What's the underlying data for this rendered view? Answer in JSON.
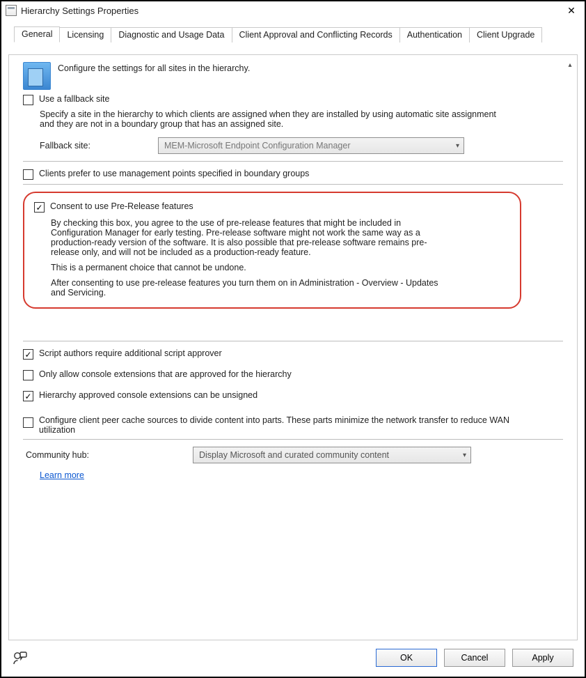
{
  "window": {
    "title": "Hierarchy Settings Properties",
    "close_glyph": "✕"
  },
  "tabs": {
    "general": "General",
    "licensing": "Licensing",
    "diag": "Diagnostic and Usage Data",
    "conflict": "Client Approval and Conflicting Records",
    "auth": "Authentication",
    "upgrade": "Client Upgrade",
    "active": "general"
  },
  "general": {
    "intro": "Configure the settings for all sites in the hierarchy.",
    "use_fallback_label": "Use a fallback site",
    "use_fallback_checked": false,
    "fallback_help": "Specify a site in the hierarchy to which clients are assigned when they are installed by using automatic site assignment and they are not in a boundary group that has an assigned site.",
    "fallback_site_label": "Fallback site:",
    "fallback_site_value": "MEM-Microsoft Endpoint Configuration Manager",
    "clients_prefer_label": "Clients prefer to use management points specified in boundary groups",
    "clients_prefer_checked": false,
    "consent_label": "Consent to use Pre-Release features",
    "consent_checked": true,
    "consent_p1": "By checking this box, you agree to the use of pre-release features that might be included in Configuration Manager for early testing. Pre-release software might not work the same way as a production-ready version of the software. It is also possible that pre-release software remains pre-release only, and will not be included as a production-ready feature.",
    "consent_p2": "This is a permanent choice that cannot be undone.",
    "consent_p3": "After consenting to use pre-release features you turn them on in Administration - Overview - Updates and Servicing.",
    "script_approver_label": "Script authors require additional script approver",
    "script_approver_checked": true,
    "only_approved_ext_label": "Only allow console extensions that are approved for the hierarchy",
    "only_approved_ext_checked": false,
    "unsigned_ext_label": "Hierarchy approved console extensions can be unsigned",
    "unsigned_ext_checked": true,
    "peer_cache_label": "Configure client peer cache sources to divide content into parts. These parts minimize the network transfer to reduce WAN utilization",
    "peer_cache_checked": false,
    "community_hub_label": "Community hub:",
    "community_hub_value": "Display Microsoft and curated community content",
    "learn_more": "Learn more"
  },
  "buttons": {
    "ok": "OK",
    "cancel": "Cancel",
    "apply": "Apply"
  }
}
